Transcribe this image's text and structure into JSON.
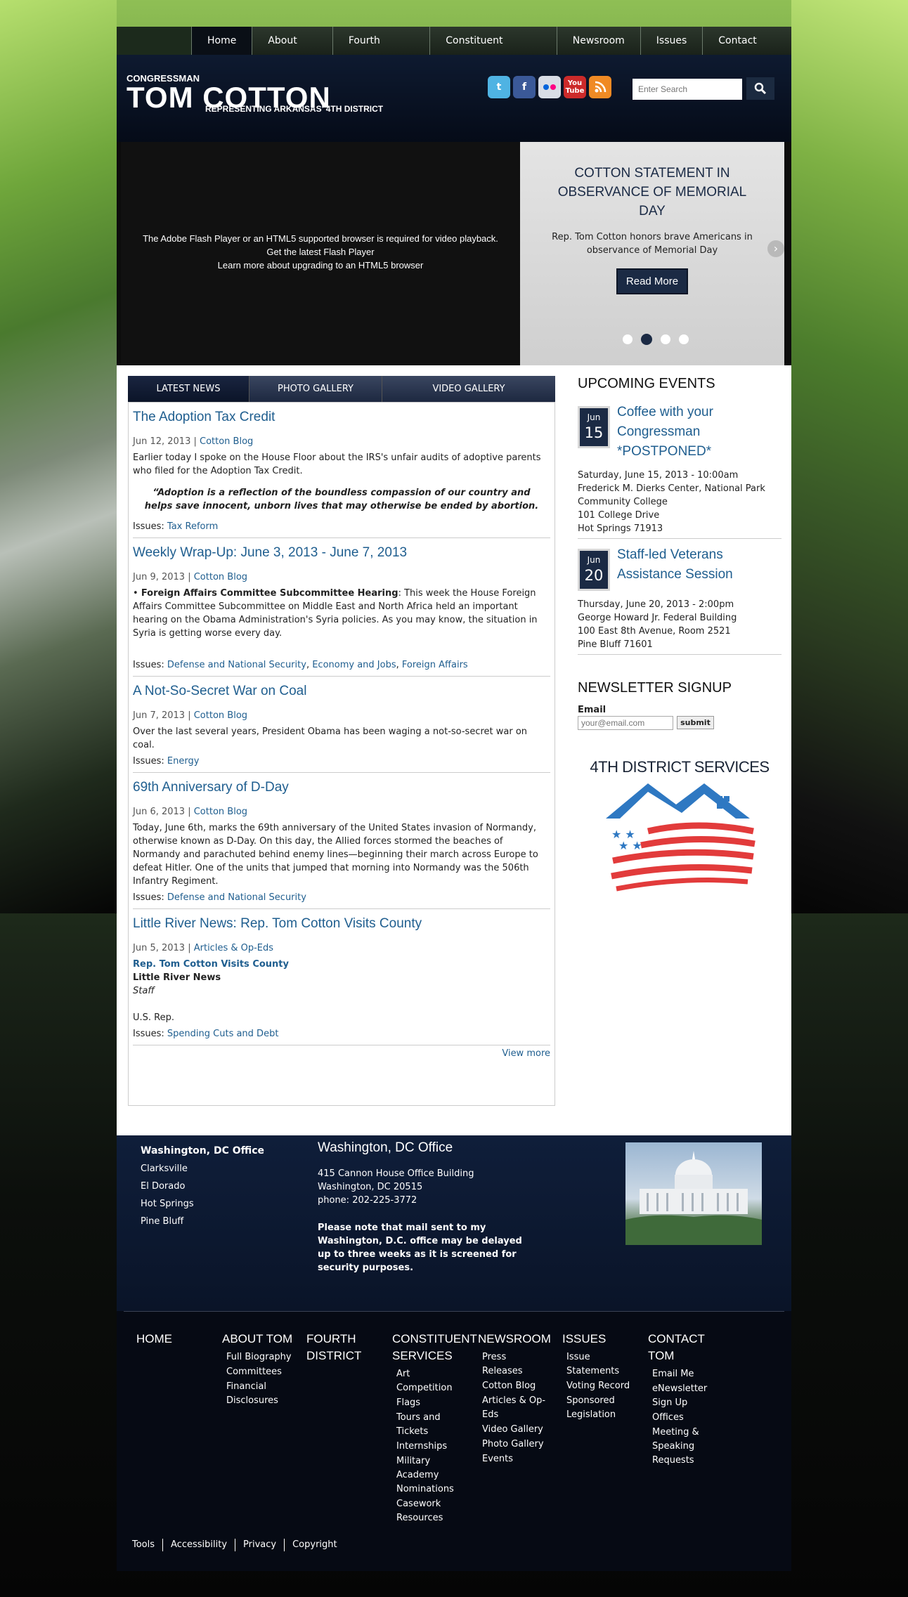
{
  "nav": {
    "items": [
      "Home",
      "About Tom",
      "Fourth District",
      "Constituent Services",
      "Newsroom",
      "Issues",
      "Contact Tom"
    ]
  },
  "header": {
    "title_small": "CONGRESSMAN",
    "title": "TOM COTTON",
    "subtitle": "REPRESENTING ARKANSAS' 4TH DISTRICT",
    "search_placeholder": "Enter Search",
    "social": [
      {
        "icon": "twitter-icon",
        "color": "#4fb3e3"
      },
      {
        "icon": "facebook-icon",
        "color": "#3b5998"
      },
      {
        "icon": "flickr-icon",
        "color": "#d9dde6"
      },
      {
        "icon": "youtube-icon",
        "color": "#cc2a2a"
      },
      {
        "icon": "rss-icon",
        "color": "#f08a24"
      }
    ]
  },
  "hero": {
    "video_msg": "The Adobe Flash Player or an HTML5 supported browser is required for video playback.",
    "video_link1": "Get the latest Flash Player",
    "video_link2": "Learn more about upgrading to an HTML5 browser",
    "slide_title": "COTTON STATEMENT IN OBSERVANCE OF MEMORIAL DAY",
    "slide_text": "Rep. Tom Cotton honors brave Americans in observance of Memorial Day",
    "read_more": "Read More",
    "active_slide": 2
  },
  "tabs": [
    "LATEST NEWS",
    "PHOTO GALLERY",
    "VIDEO GALLERY"
  ],
  "articles": [
    {
      "title": "The Adoption Tax Credit",
      "date": "Jun 12, 2013",
      "category": "Cotton Blog",
      "body": "Earlier today I spoke on the House Floor about the IRS's unfair audits of adoptive parents who filed for the Adoption Tax Credit.",
      "quote": "“Adoption is a reflection of the boundless compassion of our country and helps save innocent, unborn lives that may otherwise be ended by abortion.",
      "issues_label": "Issues:",
      "issues": "Tax Reform"
    },
    {
      "title": "Weekly Wrap-Up: June 3, 2013 - June 7, 2013",
      "date": "Jun 9, 2013",
      "category": "Cotton Blog",
      "bullet_bold": "Foreign Affairs Committee Subcommittee Hearing",
      "body": ": This week the House Foreign Affairs Committee Subcommittee on Middle East and North Africa held an important hearing on the Obama Administration's Syria policies. As you may know, the situation in Syria is getting worse every day.",
      "issues_label": "Issues:",
      "issues1": "Defense and National Security",
      "issues2": "Economy and Jobs",
      "issues3": "Foreign Affairs"
    },
    {
      "title": "A Not-So-Secret War on Coal",
      "date": "Jun 7, 2013",
      "category": "Cotton Blog",
      "body": "Over the last several years, President Obama has been waging a not-so-secret war on coal.",
      "issues_label": "Issues:",
      "issues": "Energy"
    },
    {
      "title": "69th Anniversary of D-Day",
      "date": "Jun 6, 2013",
      "category": "Cotton Blog",
      "body": "Today, June 6th, marks the 69th anniversary of the United States invasion of Normandy, otherwise known as D-Day. On this day, the Allied forces stormed the beaches of Normandy and parachuted behind enemy lines—beginning their march across Europe to defeat Hitler. One of the units that jumped that morning into Normandy was the 506th Infantry Regiment.",
      "issues_label": "Issues:",
      "issues": "Defense and National Security"
    },
    {
      "title": "Little River News: Rep. Tom Cotton Visits County",
      "date": "Jun 5, 2013",
      "category": "Articles & Op-Eds",
      "link": "Rep. Tom Cotton Visits County",
      "source": "Little River News",
      "author": "Staff",
      "body": "U.S. Rep.",
      "issues_label": "Issues:",
      "issues": "Spending Cuts and Debt"
    }
  ],
  "view_more": "View more",
  "events": {
    "heading": "UPCOMING EVENTS",
    "items": [
      {
        "month": "Jun",
        "day": "15",
        "title": "Coffee with your Congressman *POSTPONED*",
        "lines": [
          "Saturday, June 15, 2013 - 10:00am",
          "Frederick M. Dierks Center, National Park Community College",
          "101 College Drive",
          "Hot Springs 71913"
        ]
      },
      {
        "month": "Jun",
        "day": "20",
        "title": "Staff-led Veterans Assistance Session",
        "lines": [
          "Thursday, June 20, 2013 - 2:00pm",
          "George Howard Jr. Federal Building",
          "100 East 8th Avenue, Room 2521",
          "Pine Bluff 71601"
        ]
      }
    ]
  },
  "newsletter": {
    "heading": "NEWSLETTER SIGNUP",
    "label": "Email",
    "placeholder": "your@email.com",
    "button": "submit"
  },
  "district": {
    "title": "4TH DISTRICT SERVICES"
  },
  "offices": {
    "list": [
      "Washington, DC Office",
      "Clarksville",
      "El Dorado",
      "Hot Springs",
      "Pine Bluff"
    ],
    "title": "Washington, DC Office",
    "addr1": "415 Cannon House Office Building",
    "addr2": "Washington, DC 20515",
    "phone": "phone: 202-225-3772",
    "note": "Please note that mail sent to my Washington, D.C. office may be delayed up to three weeks as it is screened for security purposes."
  },
  "footer_cols": [
    {
      "heading": "HOME",
      "items": []
    },
    {
      "heading": "ABOUT TOM",
      "items": [
        "Full Biography",
        "Committees",
        "Financial Disclosures"
      ]
    },
    {
      "heading": "FOURTH DISTRICT",
      "items": []
    },
    {
      "heading": "CONSTITUENT SERVICES",
      "items": [
        "Art Competition",
        "Flags",
        "Tours and Tickets",
        "Internships",
        "Military Academy Nominations",
        "Casework Resources"
      ]
    },
    {
      "heading": "NEWSROOM",
      "items": [
        "Press Releases",
        "Cotton Blog",
        "Articles & Op-Eds",
        "Video Gallery",
        "Photo Gallery",
        "Events"
      ]
    },
    {
      "heading": "ISSUES",
      "items": [
        "Issue Statements",
        "Voting Record",
        "Sponsored Legislation"
      ]
    },
    {
      "heading": "CONTACT TOM",
      "items": [
        "Email Me",
        "eNewsletter Sign Up",
        "Offices",
        "Meeting & Speaking Requests"
      ]
    }
  ],
  "bottom_links": [
    "Tools",
    "Accessibility",
    "Privacy",
    "Copyright"
  ]
}
